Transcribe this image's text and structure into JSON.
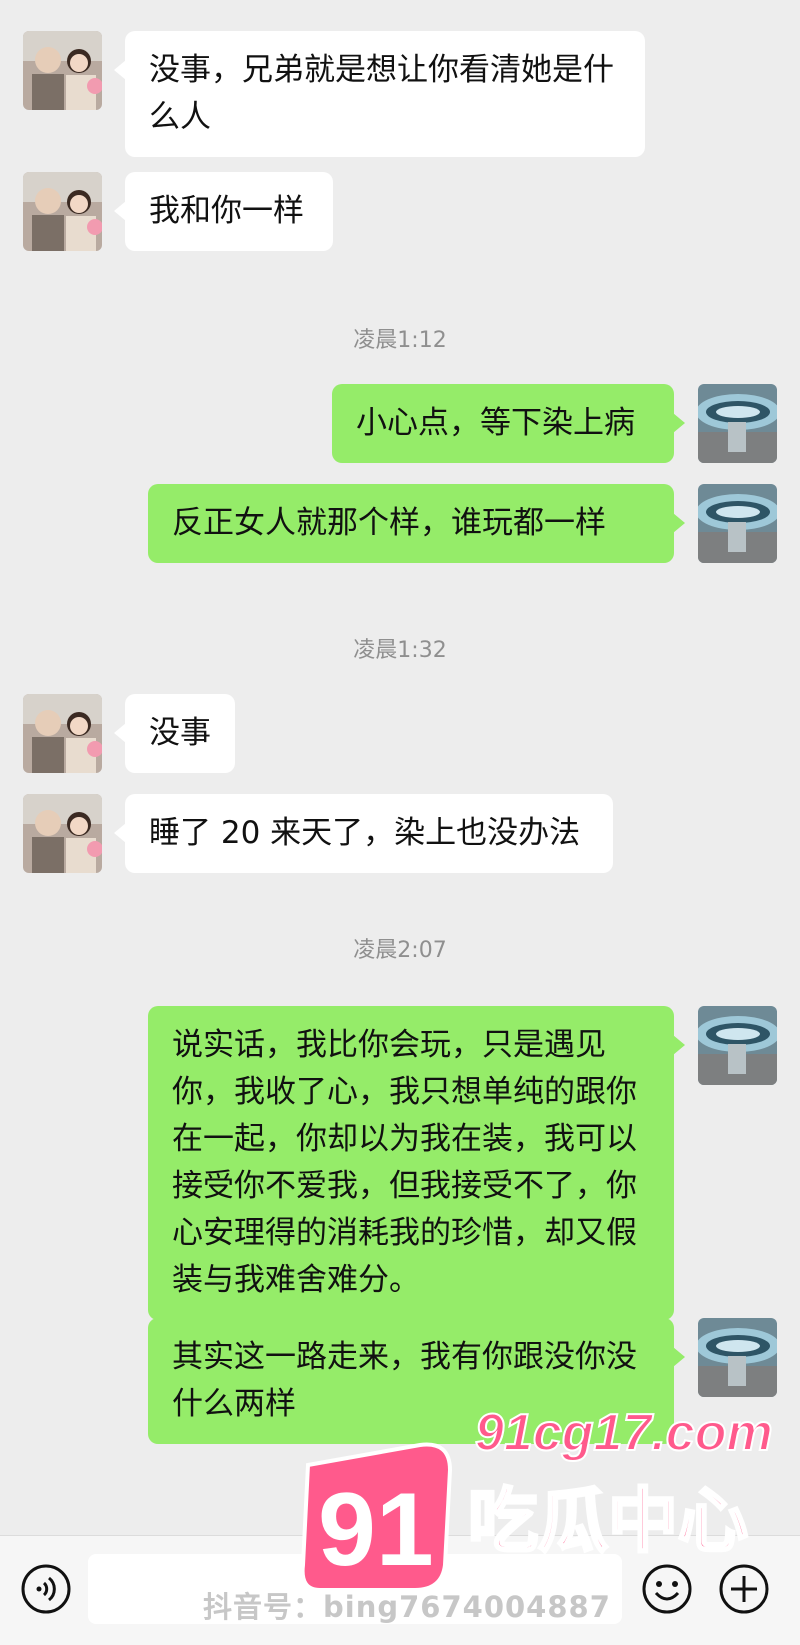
{
  "messages": [
    {
      "side": "in",
      "text": "没事，兄弟就是想让你看清她是什么人"
    },
    {
      "side": "in",
      "text": "我和你一样"
    },
    {
      "side": "time",
      "text": "凌晨1:12"
    },
    {
      "side": "out",
      "text": "小心点，等下染上病"
    },
    {
      "side": "out",
      "text": "反正女人就那个样，谁玩都一样"
    },
    {
      "side": "time",
      "text": "凌晨1:32"
    },
    {
      "side": "in",
      "text": "没事"
    },
    {
      "side": "in",
      "text": "睡了 20 来天了，染上也没办法"
    },
    {
      "side": "time",
      "text": "凌晨2:07"
    },
    {
      "side": "out",
      "text": "说实话，我比你会玩，只是遇见你，我收了心，我只想单纯的跟你在一起，你却以为我在装，我可以接受你不爱我，但我接受不了，你心安理得的消耗我的珍惜，却又假装与我难舍难分。"
    },
    {
      "side": "out",
      "text": "其实这一路走来，我有你跟没你没什么两样"
    }
  ],
  "watermark": {
    "url": "91cg17.com",
    "number": "91",
    "site_name": "吃瓜中心",
    "douyin": "抖音号：bing7674004887"
  },
  "colors": {
    "outgoing": "#95ec69",
    "incoming": "#ffffff",
    "background": "#ededed",
    "logo_pink": "#ff5a8c"
  },
  "icons": {
    "voice": "voice-icon",
    "emoji": "emoji-icon",
    "plus": "plus-icon"
  }
}
